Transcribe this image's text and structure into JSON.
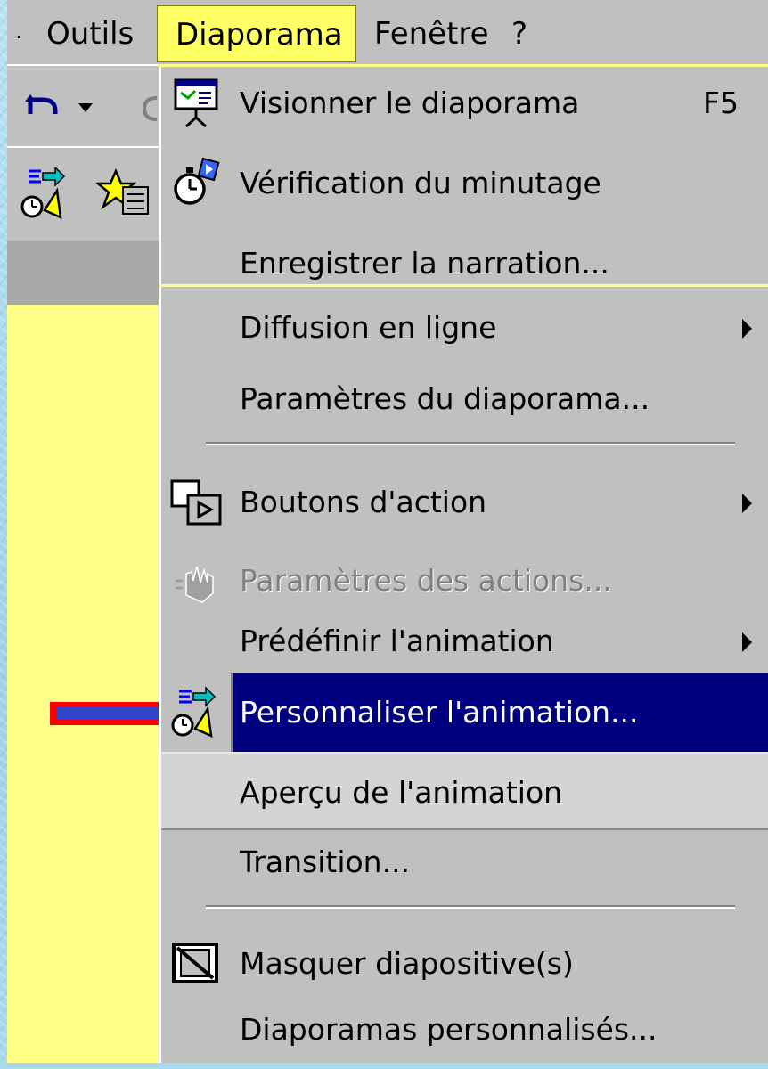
{
  "menubar": {
    "items": [
      {
        "label": "Outils"
      },
      {
        "label": "Diaporama"
      },
      {
        "label": "Fenêtre"
      },
      {
        "label": "?"
      }
    ]
  },
  "toolbar": {
    "icons": [
      "undo-icon",
      "dropdown-arrow-icon",
      "custom-animation-icon",
      "preset-animation-icon"
    ]
  },
  "menu": {
    "items": [
      {
        "label": "Visionner le diaporama",
        "shortcut": "F5",
        "icon": "slideshow-icon"
      },
      {
        "label": "Vérification du minutage",
        "icon": "stopwatch-icon"
      },
      {
        "label": "Enregistrer la narration..."
      },
      {
        "label": "Diffusion en ligne",
        "submenu": true
      },
      {
        "label": "Paramètres du diaporama..."
      },
      {
        "label": "Boutons d'action",
        "submenu": true,
        "icon": "action-buttons-icon"
      },
      {
        "label": "Paramètres des actions...",
        "disabled": true,
        "icon": "action-settings-icon"
      },
      {
        "label": "Prédéfinir l'animation",
        "submenu": true
      },
      {
        "label": "Personnaliser l'animation...",
        "selected": true,
        "icon": "custom-animation-icon"
      },
      {
        "label": "Aperçu de l'animation"
      },
      {
        "label": "Transition..."
      },
      {
        "label": "Masquer diapositive(s)",
        "icon": "hide-slide-icon"
      },
      {
        "label": "Diaporamas personnalisés..."
      }
    ]
  },
  "colors": {
    "highlight": "#000080",
    "menu_bg": "#c0c0c0",
    "active_menu_title": "#ffff66",
    "arrow_fill": "#3344cc",
    "arrow_border": "#ff0000"
  }
}
